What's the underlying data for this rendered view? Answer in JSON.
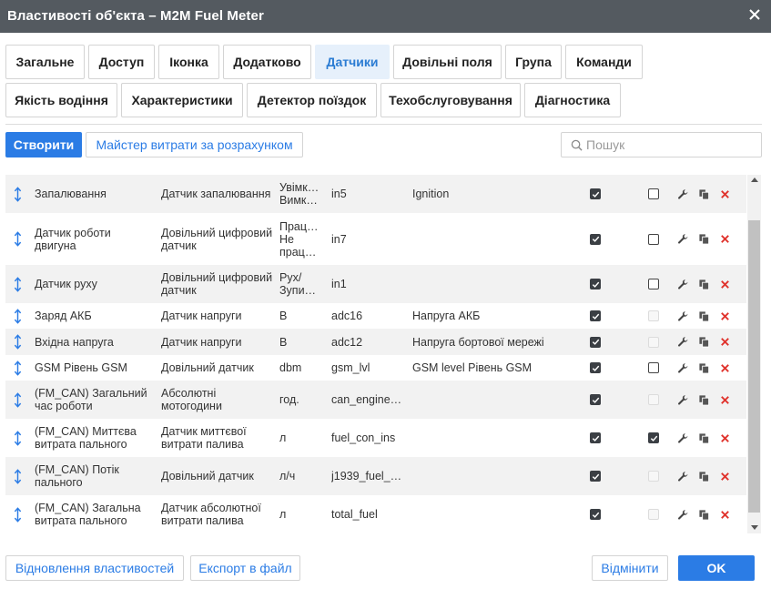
{
  "window": {
    "title": "Властивості об'єкта – M2M Fuel Meter"
  },
  "tabs_row1": [
    {
      "label": "Загальне",
      "active": false
    },
    {
      "label": "Доступ",
      "active": false
    },
    {
      "label": "Іконка",
      "active": false
    },
    {
      "label": "Додатково",
      "active": false
    },
    {
      "label": "Датчики",
      "active": true
    },
    {
      "label": "Довільні поля",
      "active": false
    },
    {
      "label": "Група",
      "active": false
    },
    {
      "label": "Команди",
      "active": false
    }
  ],
  "tabs_row2": [
    {
      "label": "Якість водіння",
      "active": false
    },
    {
      "label": "Характеристики",
      "active": false
    },
    {
      "label": "Детектор поїздок",
      "active": false
    },
    {
      "label": "Техобслуговування",
      "active": false
    },
    {
      "label": "Діагностика",
      "active": false
    }
  ],
  "toolbar": {
    "create_label": "Створити",
    "wizard_label": "Майстер витрати за розрахунком",
    "search_placeholder": "Пошук"
  },
  "sensors": [
    {
      "name": "Запалювання",
      "type": "Датчик запалювання",
      "unit": "Увімк…\nВимк…",
      "param": "in5",
      "desc": "Ignition",
      "visible": true,
      "validation": "empty"
    },
    {
      "name": "Датчик роботи двигуна",
      "type": "Довільний цифровий датчик",
      "unit": "Прац…\nНе\nпрац…",
      "param": "in7",
      "desc": "",
      "visible": true,
      "validation": "empty"
    },
    {
      "name": "Датчик руху",
      "type": "Довільний цифровий датчик",
      "unit": "Рух/\nЗупи…",
      "param": "in1",
      "desc": "",
      "visible": true,
      "validation": "empty"
    },
    {
      "name": "Заряд АКБ",
      "type": "Датчик напруги",
      "unit": "В",
      "param": "adc16",
      "desc": "Напруга АКБ",
      "visible": true,
      "validation": "disabled"
    },
    {
      "name": "Вхідна напруга",
      "type": "Датчик напруги",
      "unit": "В",
      "param": "adc12",
      "desc": "Напруга бортової мережі",
      "visible": true,
      "validation": "disabled"
    },
    {
      "name": "GSM Рівень GSM",
      "type": "Довільний датчик",
      "unit": "dbm",
      "param": "gsm_lvl",
      "desc": "GSM level Рівень GSM",
      "visible": true,
      "validation": "empty"
    },
    {
      "name": "(FM_CAN) Загальний час роботи",
      "type": "Абсолютні мотогодини",
      "unit": "год.",
      "param": "can_engine…",
      "desc": "",
      "visible": true,
      "validation": "disabled"
    },
    {
      "name": "(FM_CAN) Миттєва витрата пального",
      "type": "Датчик миттєвої витрати палива",
      "unit": "л",
      "param": "fuel_con_ins",
      "desc": "",
      "visible": true,
      "validation": "checked"
    },
    {
      "name": "(FM_CAN) Потік пального",
      "type": "Довільний датчик",
      "unit": "л/ч",
      "param": "j1939_fuel_r…",
      "desc": "",
      "visible": true,
      "validation": "disabled"
    },
    {
      "name": "(FM_CAN) Загальна витрата пального",
      "type": "Датчик абсолютної витрати палива",
      "unit": "л",
      "param": "total_fuel",
      "desc": "",
      "visible": true,
      "validation": "disabled"
    }
  ],
  "footer": {
    "restore_label": "Відновлення властивостей",
    "export_label": "Експорт в файл",
    "cancel_label": "Відмінити",
    "ok_label": "OK"
  },
  "icons": {
    "move": "up-down-arrow-icon",
    "edit": "wrench-icon",
    "copy": "copy-icon",
    "delete": "delete-x-icon",
    "search": "search-icon",
    "close": "close-icon"
  },
  "colors": {
    "titlebar": "#545a60",
    "accent": "#2b7ce5",
    "active_tab_bg": "#e6f0fb",
    "delete_red": "#e0332d"
  }
}
